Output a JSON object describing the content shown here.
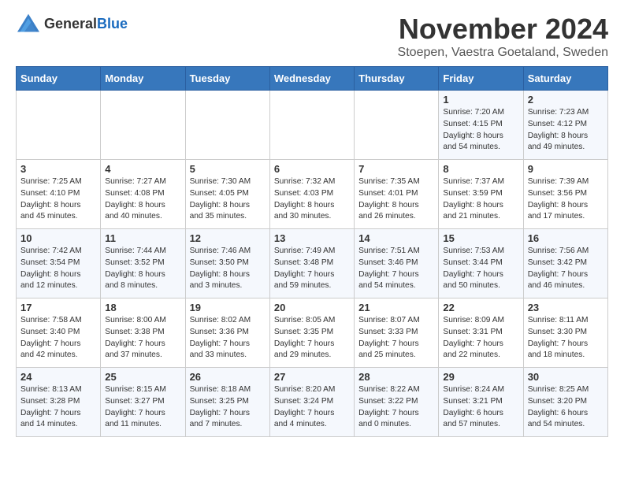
{
  "logo": {
    "general": "General",
    "blue": "Blue"
  },
  "title": "November 2024",
  "subtitle": "Stoepen, Vaestra Goetaland, Sweden",
  "headers": [
    "Sunday",
    "Monday",
    "Tuesday",
    "Wednesday",
    "Thursday",
    "Friday",
    "Saturday"
  ],
  "weeks": [
    [
      {
        "day": "",
        "info": ""
      },
      {
        "day": "",
        "info": ""
      },
      {
        "day": "",
        "info": ""
      },
      {
        "day": "",
        "info": ""
      },
      {
        "day": "",
        "info": ""
      },
      {
        "day": "1",
        "info": "Sunrise: 7:20 AM\nSunset: 4:15 PM\nDaylight: 8 hours\nand 54 minutes."
      },
      {
        "day": "2",
        "info": "Sunrise: 7:23 AM\nSunset: 4:12 PM\nDaylight: 8 hours\nand 49 minutes."
      }
    ],
    [
      {
        "day": "3",
        "info": "Sunrise: 7:25 AM\nSunset: 4:10 PM\nDaylight: 8 hours\nand 45 minutes."
      },
      {
        "day": "4",
        "info": "Sunrise: 7:27 AM\nSunset: 4:08 PM\nDaylight: 8 hours\nand 40 minutes."
      },
      {
        "day": "5",
        "info": "Sunrise: 7:30 AM\nSunset: 4:05 PM\nDaylight: 8 hours\nand 35 minutes."
      },
      {
        "day": "6",
        "info": "Sunrise: 7:32 AM\nSunset: 4:03 PM\nDaylight: 8 hours\nand 30 minutes."
      },
      {
        "day": "7",
        "info": "Sunrise: 7:35 AM\nSunset: 4:01 PM\nDaylight: 8 hours\nand 26 minutes."
      },
      {
        "day": "8",
        "info": "Sunrise: 7:37 AM\nSunset: 3:59 PM\nDaylight: 8 hours\nand 21 minutes."
      },
      {
        "day": "9",
        "info": "Sunrise: 7:39 AM\nSunset: 3:56 PM\nDaylight: 8 hours\nand 17 minutes."
      }
    ],
    [
      {
        "day": "10",
        "info": "Sunrise: 7:42 AM\nSunset: 3:54 PM\nDaylight: 8 hours\nand 12 minutes."
      },
      {
        "day": "11",
        "info": "Sunrise: 7:44 AM\nSunset: 3:52 PM\nDaylight: 8 hours\nand 8 minutes."
      },
      {
        "day": "12",
        "info": "Sunrise: 7:46 AM\nSunset: 3:50 PM\nDaylight: 8 hours\nand 3 minutes."
      },
      {
        "day": "13",
        "info": "Sunrise: 7:49 AM\nSunset: 3:48 PM\nDaylight: 7 hours\nand 59 minutes."
      },
      {
        "day": "14",
        "info": "Sunrise: 7:51 AM\nSunset: 3:46 PM\nDaylight: 7 hours\nand 54 minutes."
      },
      {
        "day": "15",
        "info": "Sunrise: 7:53 AM\nSunset: 3:44 PM\nDaylight: 7 hours\nand 50 minutes."
      },
      {
        "day": "16",
        "info": "Sunrise: 7:56 AM\nSunset: 3:42 PM\nDaylight: 7 hours\nand 46 minutes."
      }
    ],
    [
      {
        "day": "17",
        "info": "Sunrise: 7:58 AM\nSunset: 3:40 PM\nDaylight: 7 hours\nand 42 minutes."
      },
      {
        "day": "18",
        "info": "Sunrise: 8:00 AM\nSunset: 3:38 PM\nDaylight: 7 hours\nand 37 minutes."
      },
      {
        "day": "19",
        "info": "Sunrise: 8:02 AM\nSunset: 3:36 PM\nDaylight: 7 hours\nand 33 minutes."
      },
      {
        "day": "20",
        "info": "Sunrise: 8:05 AM\nSunset: 3:35 PM\nDaylight: 7 hours\nand 29 minutes."
      },
      {
        "day": "21",
        "info": "Sunrise: 8:07 AM\nSunset: 3:33 PM\nDaylight: 7 hours\nand 25 minutes."
      },
      {
        "day": "22",
        "info": "Sunrise: 8:09 AM\nSunset: 3:31 PM\nDaylight: 7 hours\nand 22 minutes."
      },
      {
        "day": "23",
        "info": "Sunrise: 8:11 AM\nSunset: 3:30 PM\nDaylight: 7 hours\nand 18 minutes."
      }
    ],
    [
      {
        "day": "24",
        "info": "Sunrise: 8:13 AM\nSunset: 3:28 PM\nDaylight: 7 hours\nand 14 minutes."
      },
      {
        "day": "25",
        "info": "Sunrise: 8:15 AM\nSunset: 3:27 PM\nDaylight: 7 hours\nand 11 minutes."
      },
      {
        "day": "26",
        "info": "Sunrise: 8:18 AM\nSunset: 3:25 PM\nDaylight: 7 hours\nand 7 minutes."
      },
      {
        "day": "27",
        "info": "Sunrise: 8:20 AM\nSunset: 3:24 PM\nDaylight: 7 hours\nand 4 minutes."
      },
      {
        "day": "28",
        "info": "Sunrise: 8:22 AM\nSunset: 3:22 PM\nDaylight: 7 hours\nand 0 minutes."
      },
      {
        "day": "29",
        "info": "Sunrise: 8:24 AM\nSunset: 3:21 PM\nDaylight: 6 hours\nand 57 minutes."
      },
      {
        "day": "30",
        "info": "Sunrise: 8:25 AM\nSunset: 3:20 PM\nDaylight: 6 hours\nand 54 minutes."
      }
    ]
  ]
}
